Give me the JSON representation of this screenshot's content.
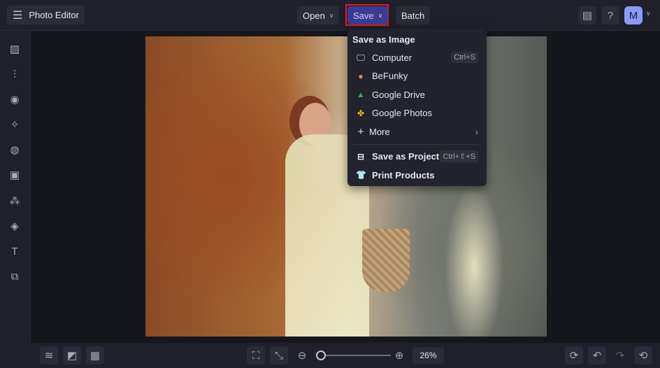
{
  "header": {
    "title": "Photo Editor",
    "open_label": "Open",
    "save_label": "Save",
    "batch_label": "Batch",
    "avatar_initial": "M"
  },
  "save_menu": {
    "heading": "Save as Image",
    "items": [
      {
        "label": "Computer",
        "shortcut": "Ctrl+S"
      },
      {
        "label": "BeFunky"
      },
      {
        "label": "Google Drive"
      },
      {
        "label": "Google Photos"
      },
      {
        "label": "More"
      }
    ],
    "project": {
      "label": "Save as Project",
      "shortcut": "Ctrl+⇧+S"
    },
    "print": {
      "label": "Print Products"
    }
  },
  "footer": {
    "zoom_value": "26%",
    "zoom_fraction": 0.26
  },
  "colors": {
    "accent": "#3a3d8f",
    "highlight": "#e01b24",
    "avatar": "#8a9bf5"
  }
}
